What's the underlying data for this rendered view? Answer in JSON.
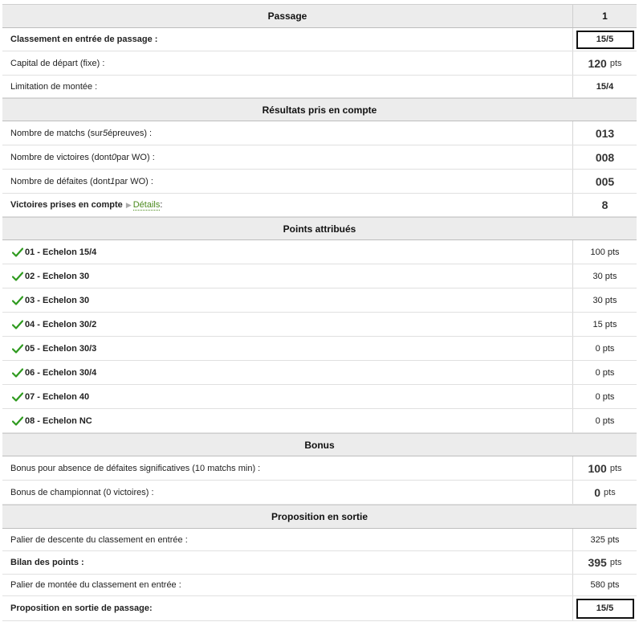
{
  "passage": {
    "title": "Passage",
    "col": "1",
    "rows": [
      {
        "label": "Classement en entrée de passage :",
        "value": "15/5",
        "bold": true,
        "boxed": true
      },
      {
        "label": "Capital de départ (fixe) :",
        "value": "120",
        "unit": "pts",
        "big": true
      },
      {
        "label": "Limitation de montée :",
        "value": "15/4",
        "bold_value": true
      }
    ]
  },
  "resultats": {
    "title": "Résultats pris en compte",
    "matchs_label_a": "Nombre de matchs (sur ",
    "matchs_label_i": "5",
    "matchs_label_b": " épreuves) :",
    "matchs_value": "013",
    "victoires_label_a": "Nombre de victoires (dont ",
    "victoires_label_i": "0",
    "victoires_label_b": " par WO) :",
    "victoires_value": "008",
    "defaites_label_a": "Nombre de défaites (dont ",
    "defaites_label_i": "1",
    "defaites_label_b": " par WO) :",
    "defaites_value": "005",
    "prises_label": "Victoires prises en compte",
    "details_label": "Détails",
    "prises_colon": " :",
    "prises_value": "8"
  },
  "points": {
    "title": "Points attribués",
    "items": [
      {
        "label": "01 - Echelon 15/4",
        "value": "100 pts"
      },
      {
        "label": "02 - Echelon 30",
        "value": "30 pts"
      },
      {
        "label": "03 - Echelon 30",
        "value": "30 pts"
      },
      {
        "label": "04 - Echelon 30/2",
        "value": "15 pts"
      },
      {
        "label": "05 - Echelon 30/3",
        "value": "0 pts"
      },
      {
        "label": "06 - Echelon 30/4",
        "value": "0 pts"
      },
      {
        "label": "07 - Echelon 40",
        "value": "0 pts"
      },
      {
        "label": "08 - Echelon NC",
        "value": "0 pts"
      }
    ]
  },
  "bonus": {
    "title": "Bonus",
    "absence_label": "Bonus pour absence de défaites significatives (10 matchs min) :",
    "absence_value": "100",
    "absence_unit": "pts",
    "championnat_label": "Bonus de championnat (0 victoires) :",
    "championnat_value": "0",
    "championnat_unit": "pts"
  },
  "sortie": {
    "title": "Proposition en sortie",
    "descente_label": "Palier de descente du classement en entrée :",
    "descente_value": "325 pts",
    "bilan_label": "Bilan des points :",
    "bilan_value": "395",
    "bilan_unit": "pts",
    "montee_label": "Palier de montée du classement en entrée :",
    "montee_value": "580 pts",
    "proposition_label": "Proposition en sortie de passage:",
    "proposition_value": "15/5"
  },
  "colors": {
    "check": "#2e9a1e",
    "details_link": "#4a8a1c",
    "header_bg": "#ececec"
  }
}
